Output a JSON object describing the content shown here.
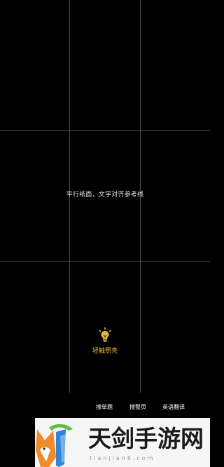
{
  "camera": {
    "guide_text": "平行纸面，文字对齐参考线"
  },
  "torch": {
    "label": "轻触照亮",
    "icon": "lightbulb-icon",
    "color": "#e7b53c"
  },
  "modes": [
    {
      "label": "搜单题"
    },
    {
      "label": "搜整页"
    },
    {
      "label": "英语翻译"
    }
  ],
  "watermark": {
    "title": "天剑手游网",
    "url": "tianjian8.com"
  }
}
